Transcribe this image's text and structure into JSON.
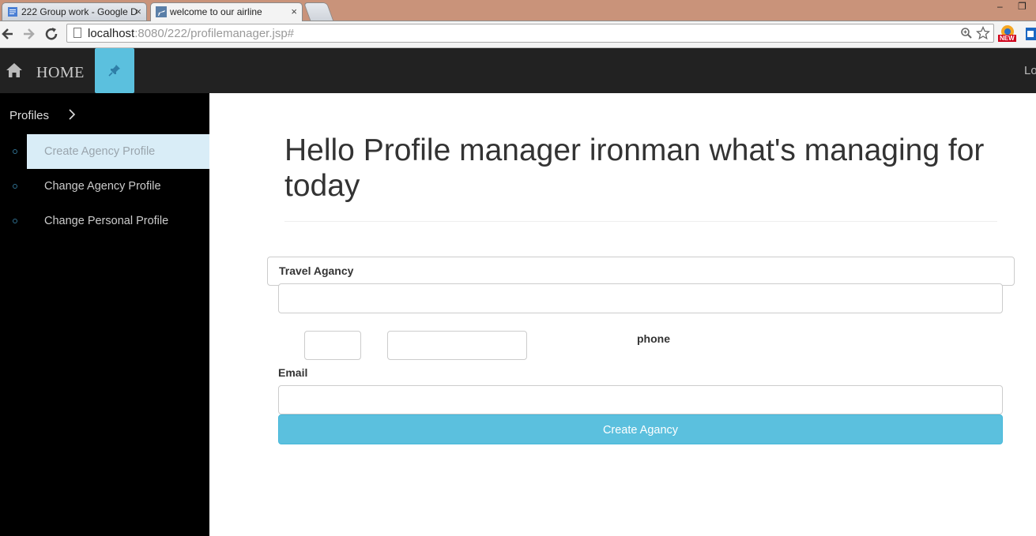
{
  "browser": {
    "tabs": [
      {
        "title": "222 Group work - Google D",
        "active": false
      },
      {
        "title": "welcome to our airline",
        "active": true
      }
    ],
    "tab_close_glyph": "×",
    "url_host": "localhost",
    "url_path": ":8080/222/profilemanager.jsp#",
    "extension_badge": "NEW",
    "window_controls": {
      "minimize": "–",
      "maximize": "❐"
    }
  },
  "navbar": {
    "home_label": "HOME",
    "right_text": "Log out",
    "pin_color": "#5bc0de",
    "icons": [
      "home-icon",
      "pushpin-icon"
    ]
  },
  "sidebar": {
    "header": "Profiles",
    "items": [
      {
        "label": "Create Agency Profile",
        "active": true
      },
      {
        "label": "Change Agency Profile",
        "active": false
      },
      {
        "label": "Change Personal Profile",
        "active": false
      }
    ]
  },
  "main": {
    "heading": "Hello Profile manager ironman what's managing for today",
    "form": {
      "travel_agency_label": "Travel Agancy",
      "travel_agency_value": "",
      "phone_area_value": "",
      "phone_number_value": "",
      "phone_label": "phone",
      "email_label": "Email",
      "email_value": "",
      "submit_label": "Create Agancy"
    }
  },
  "colors": {
    "accent": "#5bc0de",
    "navbar_bg": "#222222",
    "sidebar_bg": "#000000",
    "active_item_bg": "#d9edf7"
  }
}
